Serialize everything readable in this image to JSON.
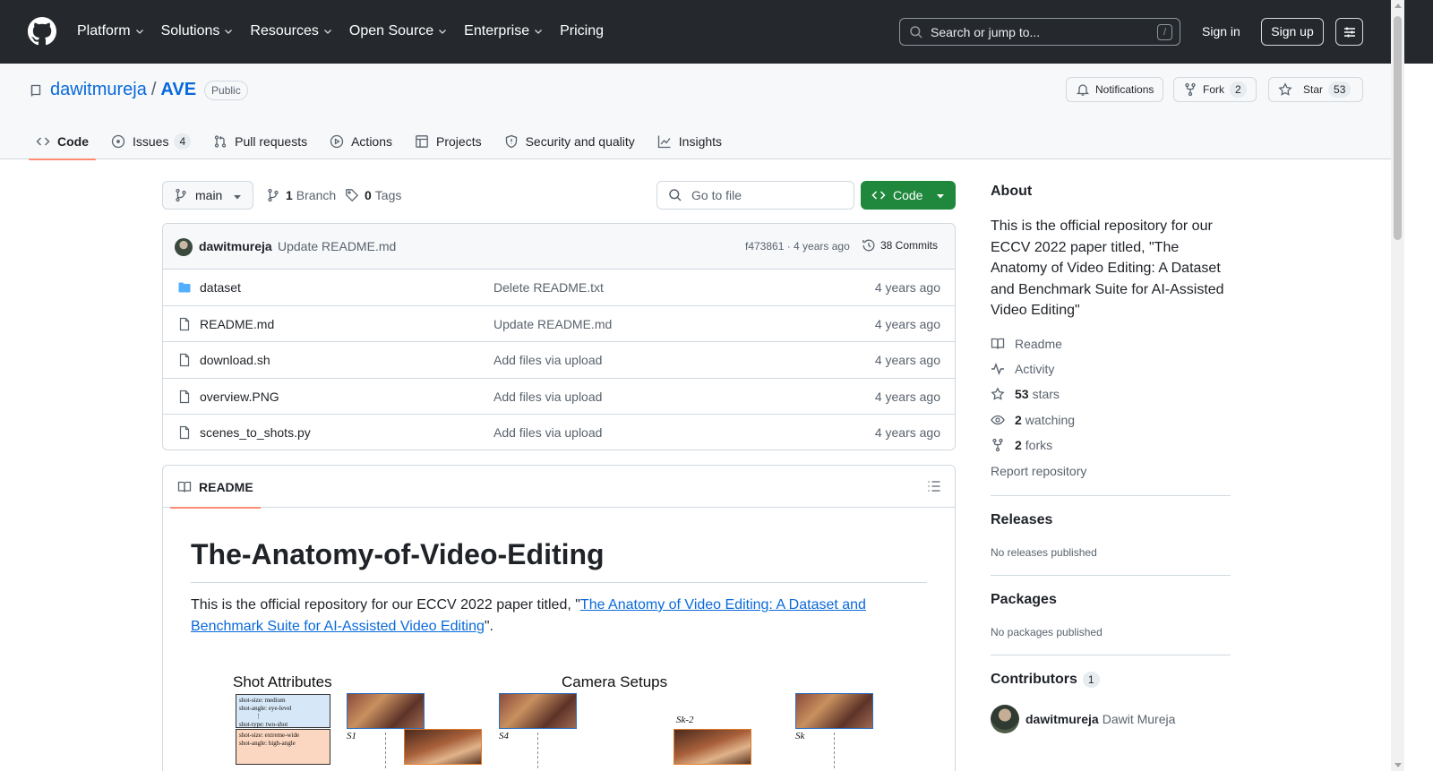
{
  "header": {
    "nav": [
      "Platform",
      "Solutions",
      "Resources",
      "Open Source",
      "Enterprise",
      "Pricing"
    ],
    "search_placeholder": "Search or jump to...",
    "search_shortcut": "/",
    "signin": "Sign in",
    "signup": "Sign up"
  },
  "repo": {
    "owner": "dawitmureja",
    "separator": "/",
    "name": "AVE",
    "visibility": "Public",
    "notifications_label": "Notifications",
    "fork_label": "Fork",
    "fork_count": "2",
    "star_label": "Star",
    "star_count": "53",
    "tabs": [
      {
        "label": "Code"
      },
      {
        "label": "Issues",
        "count": "4"
      },
      {
        "label": "Pull requests"
      },
      {
        "label": "Actions"
      },
      {
        "label": "Projects"
      },
      {
        "label": "Security and quality"
      },
      {
        "label": "Insights"
      }
    ]
  },
  "toolbar": {
    "branch": "main",
    "branch_count": "1",
    "branch_word": "Branch",
    "tag_count": "0",
    "tag_word": "Tags",
    "goto_placeholder": "Go to file",
    "code_button": "Code"
  },
  "latest_commit": {
    "author": "dawitmureja",
    "message": "Update README.md",
    "meta": "f473861 · 4 years ago",
    "count": "38 Commits"
  },
  "files": [
    {
      "name": "dataset",
      "type": "folder",
      "commit": "Delete README.txt",
      "age": "4 years ago"
    },
    {
      "name": "README.md",
      "type": "file",
      "commit": "Update README.md",
      "age": "4 years ago"
    },
    {
      "name": "download.sh",
      "type": "file",
      "commit": "Add files via upload",
      "age": "4 years ago"
    },
    {
      "name": "overview.PNG",
      "type": "file",
      "commit": "Add files via upload",
      "age": "4 years ago"
    },
    {
      "name": "scenes_to_shots.py",
      "type": "file",
      "commit": "Add files via upload",
      "age": "4 years ago"
    }
  ],
  "readme": {
    "tab": "README",
    "title": "The-Anatomy-of-Video-Editing",
    "para_prefix": "This is the official repository for our ECCV 2022 paper titled, \"",
    "para_link": "The Anatomy of Video Editing: A Dataset and Benchmark Suite for AI-Assisted Video Editing",
    "para_suffix": "\".",
    "figure": {
      "left_title": "Shot Attributes",
      "right_title": "Camera Setups",
      "card1": [
        "shot-size: medium",
        "shot-angle: eye-level",
        "⋮",
        "shot-type: two-shot"
      ],
      "card2": [
        "shot-size: extreme-wide",
        "shot-angle: high-angle"
      ],
      "labels": [
        "S1",
        "S4",
        "Sk-2",
        "Sk"
      ]
    }
  },
  "about": {
    "title": "About",
    "description": "This is the official repository for our ECCV 2022 paper titled, \"The Anatomy of Video Editing: A Dataset and Benchmark Suite for AI-Assisted Video Editing\"",
    "readme": "Readme",
    "activity": "Activity",
    "stars_count": "53",
    "stars_word": "stars",
    "watching_count": "2",
    "watching_word": "watching",
    "forks_count": "2",
    "forks_word": "forks",
    "report": "Report repository"
  },
  "releases": {
    "title": "Releases",
    "empty": "No releases published"
  },
  "packages": {
    "title": "Packages",
    "empty": "No packages published"
  },
  "contributors": {
    "title": "Contributors",
    "count": "1",
    "login": "dawitmureja",
    "name": "Dawit Mureja"
  },
  "colors": {
    "accent": "#0969da",
    "green": "#1f883d",
    "header_bg": "#25292e",
    "tab_underline": "#fd8c73"
  }
}
